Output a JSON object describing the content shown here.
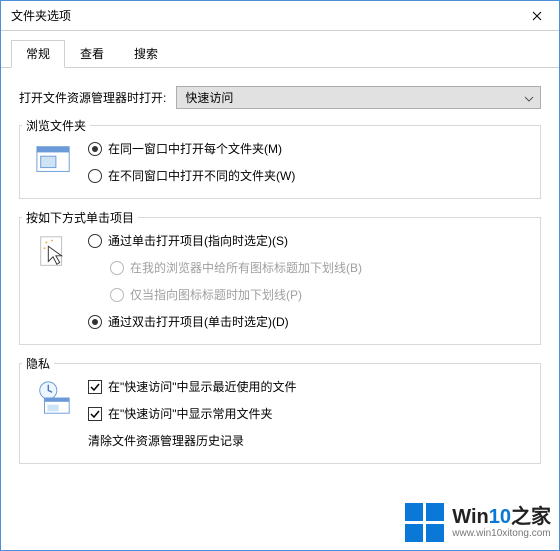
{
  "window": {
    "title": "文件夹选项"
  },
  "tabs": {
    "general": "常规",
    "view": "查看",
    "search": "搜索"
  },
  "open_with": {
    "label": "打开文件资源管理器时打开:",
    "value": "快速访问"
  },
  "browse": {
    "legend": "浏览文件夹",
    "opt_same": "在同一窗口中打开每个文件夹(M)",
    "opt_new": "在不同窗口中打开不同的文件夹(W)"
  },
  "click": {
    "legend": "按如下方式单击项目",
    "opt_single": "通过单击打开项目(指向时选定)(S)",
    "sub_browser": "在我的浏览器中给所有图标标题加下划线(B)",
    "sub_point": "仅当指向图标标题时加下划线(P)",
    "opt_double": "通过双击打开项目(单击时选定)(D)"
  },
  "privacy": {
    "legend": "隐私",
    "chk_recent": "在\"快速访问\"中显示最近使用的文件",
    "chk_frequent": "在\"快速访问\"中显示常用文件夹",
    "clear_label": "清除文件资源管理器历史记录"
  },
  "watermark": {
    "brand1": "Win",
    "brand2": "10",
    "brand3": "之家",
    "url": "www.win10xitong.com"
  }
}
